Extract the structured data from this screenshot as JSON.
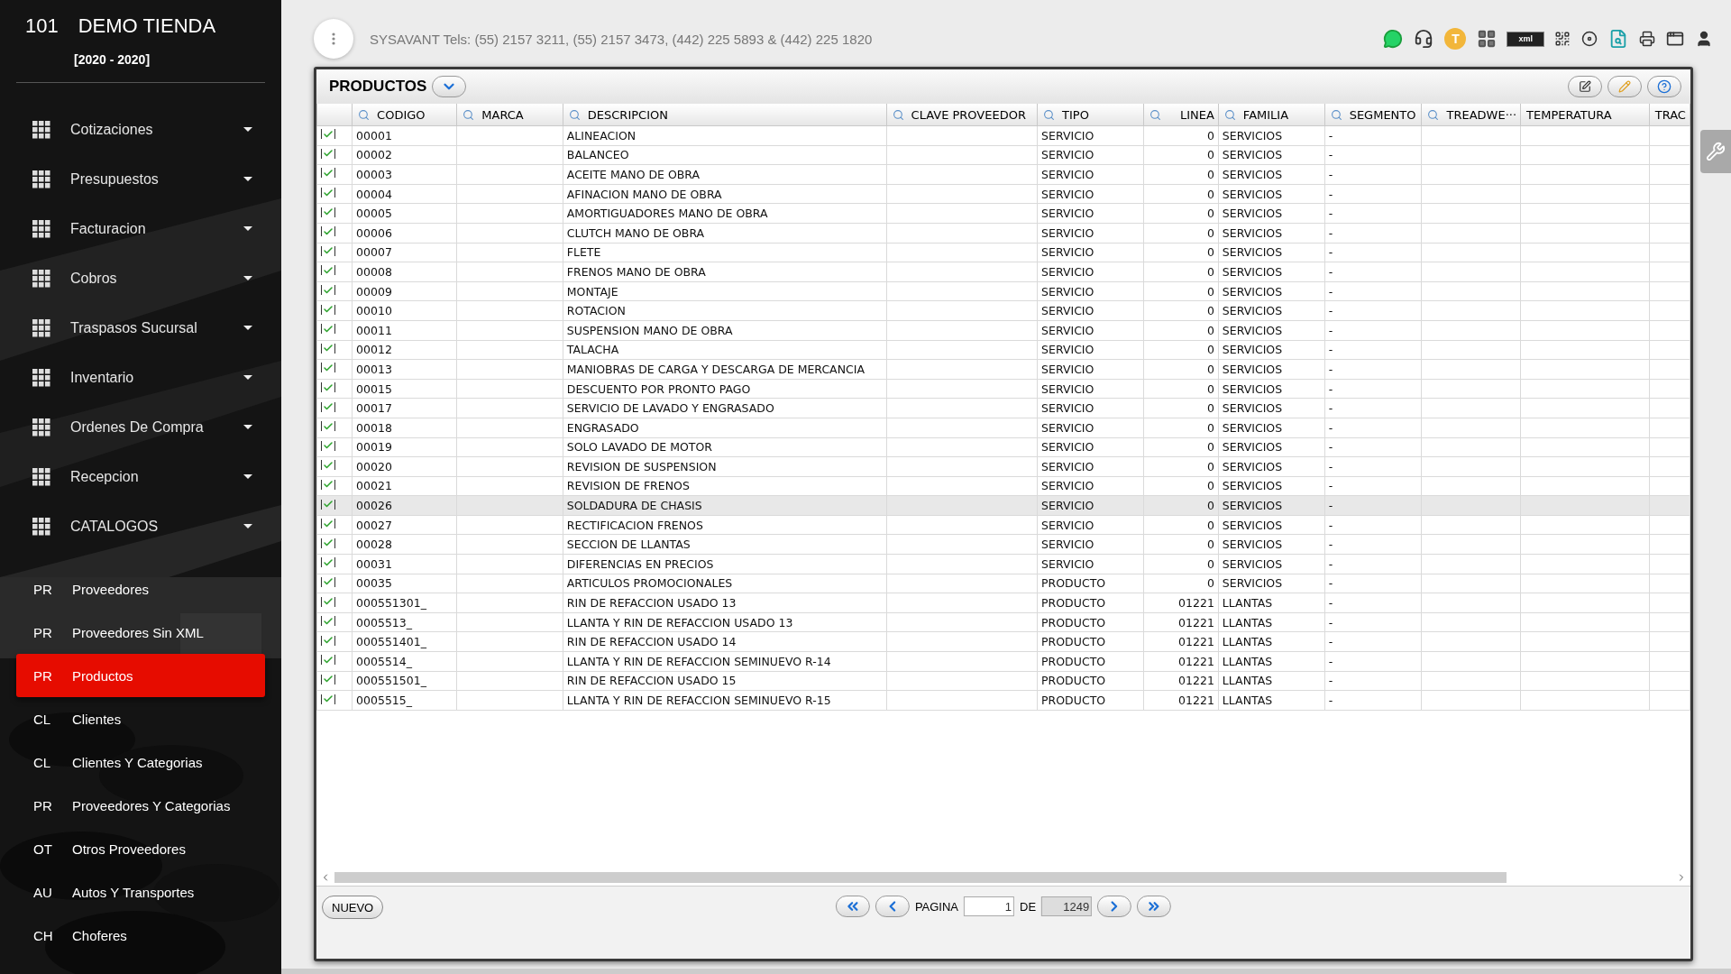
{
  "sidebar": {
    "store_number": "101",
    "store_name": "DEMO TIENDA",
    "period": "[2020 - 2020]",
    "menu": [
      {
        "label": "Cotizaciones"
      },
      {
        "label": "Presupuestos"
      },
      {
        "label": "Facturacion"
      },
      {
        "label": "Cobros"
      },
      {
        "label": "Traspasos Sucursal"
      },
      {
        "label": "Inventario"
      },
      {
        "label": "Ordenes De Compra"
      },
      {
        "label": "Recepcion"
      },
      {
        "label": "CATALOGOS"
      }
    ],
    "catalog_items": [
      {
        "abbr": "PR",
        "label": "Proveedores",
        "selected": false
      },
      {
        "abbr": "PR",
        "label": "Proveedores Sin XML",
        "selected": false
      },
      {
        "abbr": "PR",
        "label": "Productos",
        "selected": true
      },
      {
        "abbr": "CL",
        "label": "Clientes",
        "selected": false
      },
      {
        "abbr": "CL",
        "label": "Clientes Y Categorias",
        "selected": false
      },
      {
        "abbr": "PR",
        "label": "Proveedores Y Categorias",
        "selected": false
      },
      {
        "abbr": "OT",
        "label": "Otros Proveedores",
        "selected": false
      },
      {
        "abbr": "AU",
        "label": "Autos Y Transportes",
        "selected": false
      },
      {
        "abbr": "CH",
        "label": "Choferes",
        "selected": false
      }
    ]
  },
  "topbar": {
    "contact": "SYSAVANT Tels: (55) 2157 3211, (55) 2157 3473, (442) 225 5893 & (442) 225 1820",
    "user_initial": "T",
    "xml_label": "xml"
  },
  "panel": {
    "title": "PRODUCTOS",
    "columns": [
      {
        "label": "CODIGO",
        "searchable": true
      },
      {
        "label": "MARCA",
        "searchable": true
      },
      {
        "label": "DESCRIPCION",
        "searchable": true
      },
      {
        "label": "CLAVE PROVEEDOR",
        "searchable": true
      },
      {
        "label": "TIPO",
        "searchable": true
      },
      {
        "label": "LINEA",
        "searchable": true
      },
      {
        "label": "FAMILIA",
        "searchable": true
      },
      {
        "label": "SEGMENTO",
        "searchable": true
      },
      {
        "label": "TREADWE···",
        "searchable": true
      },
      {
        "label": "TEMPERATURA",
        "searchable": false
      },
      {
        "label": "TRAC",
        "searchable": false
      }
    ],
    "rows": [
      {
        "checked": true,
        "selected": false,
        "codigo": "00001",
        "descripcion": "ALINEACION",
        "tipo": "SERVICIO",
        "linea": "0",
        "familia": "SERVICIOS",
        "segmento": "-"
      },
      {
        "checked": true,
        "selected": false,
        "codigo": "00002",
        "descripcion": "BALANCEO",
        "tipo": "SERVICIO",
        "linea": "0",
        "familia": "SERVICIOS",
        "segmento": "-"
      },
      {
        "checked": true,
        "selected": false,
        "codigo": "00003",
        "descripcion": "ACEITE MANO DE OBRA",
        "tipo": "SERVICIO",
        "linea": "0",
        "familia": "SERVICIOS",
        "segmento": "-"
      },
      {
        "checked": true,
        "selected": false,
        "codigo": "00004",
        "descripcion": "AFINACION MANO DE OBRA",
        "tipo": "SERVICIO",
        "linea": "0",
        "familia": "SERVICIOS",
        "segmento": "-"
      },
      {
        "checked": true,
        "selected": false,
        "codigo": "00005",
        "descripcion": "AMORTIGUADORES MANO DE OBRA",
        "tipo": "SERVICIO",
        "linea": "0",
        "familia": "SERVICIOS",
        "segmento": "-"
      },
      {
        "checked": true,
        "selected": false,
        "codigo": "00006",
        "descripcion": "CLUTCH MANO DE OBRA",
        "tipo": "SERVICIO",
        "linea": "0",
        "familia": "SERVICIOS",
        "segmento": "-"
      },
      {
        "checked": true,
        "selected": false,
        "codigo": "00007",
        "descripcion": "FLETE",
        "tipo": "SERVICIO",
        "linea": "0",
        "familia": "SERVICIOS",
        "segmento": "-"
      },
      {
        "checked": true,
        "selected": false,
        "codigo": "00008",
        "descripcion": "FRENOS MANO DE OBRA",
        "tipo": "SERVICIO",
        "linea": "0",
        "familia": "SERVICIOS",
        "segmento": "-"
      },
      {
        "checked": true,
        "selected": false,
        "codigo": "00009",
        "descripcion": "MONTAJE",
        "tipo": "SERVICIO",
        "linea": "0",
        "familia": "SERVICIOS",
        "segmento": "-"
      },
      {
        "checked": true,
        "selected": false,
        "codigo": "00010",
        "descripcion": "ROTACION",
        "tipo": "SERVICIO",
        "linea": "0",
        "familia": "SERVICIOS",
        "segmento": "-"
      },
      {
        "checked": true,
        "selected": false,
        "codigo": "00011",
        "descripcion": "SUSPENSION MANO DE OBRA",
        "tipo": "SERVICIO",
        "linea": "0",
        "familia": "SERVICIOS",
        "segmento": "-"
      },
      {
        "checked": true,
        "selected": false,
        "codigo": "00012",
        "descripcion": "TALACHA",
        "tipo": "SERVICIO",
        "linea": "0",
        "familia": "SERVICIOS",
        "segmento": "-"
      },
      {
        "checked": true,
        "selected": false,
        "codigo": "00013",
        "descripcion": "MANIOBRAS DE CARGA Y DESCARGA DE MERCANCIA",
        "tipo": "SERVICIO",
        "linea": "0",
        "familia": "SERVICIOS",
        "segmento": "-"
      },
      {
        "checked": true,
        "selected": false,
        "codigo": "00015",
        "descripcion": "DESCUENTO POR PRONTO PAGO",
        "tipo": "SERVICIO",
        "linea": "0",
        "familia": "SERVICIOS",
        "segmento": "-"
      },
      {
        "checked": true,
        "selected": false,
        "codigo": "00017",
        "descripcion": "SERVICIO DE LAVADO Y ENGRASADO",
        "tipo": "SERVICIO",
        "linea": "0",
        "familia": "SERVICIOS",
        "segmento": "-"
      },
      {
        "checked": true,
        "selected": false,
        "codigo": "00018",
        "descripcion": "ENGRASADO",
        "tipo": "SERVICIO",
        "linea": "0",
        "familia": "SERVICIOS",
        "segmento": "-"
      },
      {
        "checked": true,
        "selected": false,
        "codigo": "00019",
        "descripcion": "SOLO LAVADO DE MOTOR",
        "tipo": "SERVICIO",
        "linea": "0",
        "familia": "SERVICIOS",
        "segmento": "-"
      },
      {
        "checked": true,
        "selected": false,
        "codigo": "00020",
        "descripcion": "REVISION DE SUSPENSION",
        "tipo": "SERVICIO",
        "linea": "0",
        "familia": "SERVICIOS",
        "segmento": "-"
      },
      {
        "checked": true,
        "selected": false,
        "codigo": "00021",
        "descripcion": "REVISION DE FRENOS",
        "tipo": "SERVICIO",
        "linea": "0",
        "familia": "SERVICIOS",
        "segmento": "-"
      },
      {
        "checked": true,
        "selected": true,
        "codigo": "00026",
        "descripcion": "SOLDADURA DE CHASIS",
        "tipo": "SERVICIO",
        "linea": "0",
        "familia": "SERVICIOS",
        "segmento": "-"
      },
      {
        "checked": true,
        "selected": false,
        "codigo": "00027",
        "descripcion": "RECTIFICACION FRENOS",
        "tipo": "SERVICIO",
        "linea": "0",
        "familia": "SERVICIOS",
        "segmento": "-"
      },
      {
        "checked": true,
        "selected": false,
        "codigo": "00028",
        "descripcion": "SECCION DE LLANTAS",
        "tipo": "SERVICIO",
        "linea": "0",
        "familia": "SERVICIOS",
        "segmento": "-"
      },
      {
        "checked": true,
        "selected": false,
        "codigo": "00031",
        "descripcion": "DIFERENCIAS EN PRECIOS",
        "tipo": "SERVICIO",
        "linea": "0",
        "familia": "SERVICIOS",
        "segmento": "-"
      },
      {
        "checked": true,
        "selected": false,
        "codigo": "00035",
        "descripcion": "ARTICULOS PROMOCIONALES",
        "tipo": "PRODUCTO",
        "linea": "0",
        "familia": "SERVICIOS",
        "segmento": "-"
      },
      {
        "checked": true,
        "selected": false,
        "codigo": "000551301_",
        "descripcion": "RIN DE REFACCION USADO 13",
        "tipo": "PRODUCTO",
        "linea": "01221",
        "familia": "LLANTAS",
        "segmento": "-"
      },
      {
        "checked": true,
        "selected": false,
        "codigo": "0005513_",
        "descripcion": "LLANTA Y RIN DE REFACCION USADO 13",
        "tipo": "PRODUCTO",
        "linea": "01221",
        "familia": "LLANTAS",
        "segmento": "-"
      },
      {
        "checked": true,
        "selected": false,
        "codigo": "000551401_",
        "descripcion": "RIN DE REFACCION USADO 14",
        "tipo": "PRODUCTO",
        "linea": "01221",
        "familia": "LLANTAS",
        "segmento": "-"
      },
      {
        "checked": true,
        "selected": false,
        "codigo": "0005514_",
        "descripcion": "LLANTA Y RIN DE REFACCION SEMINUEVO R-14",
        "tipo": "PRODUCTO",
        "linea": "01221",
        "familia": "LLANTAS",
        "segmento": "-"
      },
      {
        "checked": true,
        "selected": false,
        "codigo": "000551501_",
        "descripcion": "RIN DE REFACCION USADO 15",
        "tipo": "PRODUCTO",
        "linea": "01221",
        "familia": "LLANTAS",
        "segmento": "-"
      },
      {
        "checked": true,
        "selected": false,
        "codigo": "0005515_",
        "descripcion": "LLANTA Y RIN DE REFACCION SEMINUEVO R-15",
        "tipo": "PRODUCTO",
        "linea": "01221",
        "familia": "LLANTAS",
        "segmento": "-"
      }
    ],
    "new_button": "NUEVO",
    "page_label": "PAGINA",
    "page_value": "1",
    "of_label": "DE",
    "total_pages": "1249"
  }
}
